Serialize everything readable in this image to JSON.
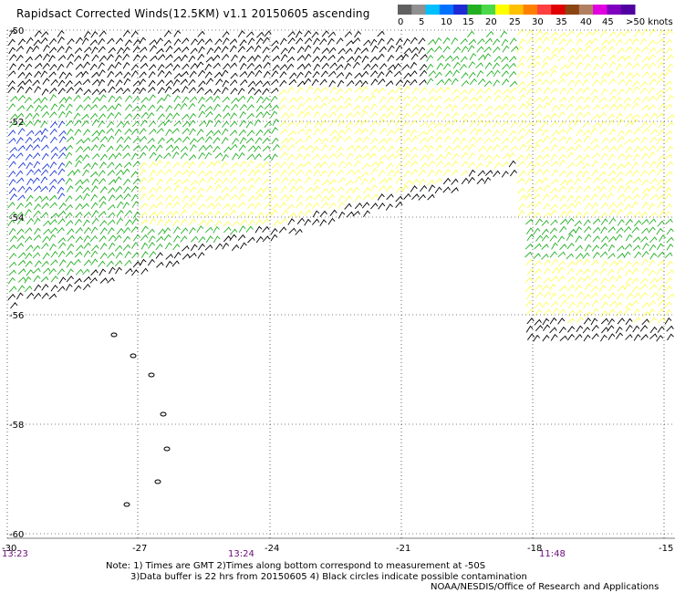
{
  "title": "Rapidsact Corrected Winds(12.5KM) v1.1 20150605 ascending",
  "legend": {
    "colors": [
      "#606060",
      "#909090",
      "#00bfff",
      "#0070ff",
      "#1e2ad6",
      "#22b022",
      "#4ad84a",
      "#ffff00",
      "#ffc000",
      "#ff8000",
      "#ff4040",
      "#e00000",
      "#8b4513",
      "#b08060",
      "#e000e0",
      "#8000c0",
      "#5000a0"
    ],
    "labels": [
      "0",
      "5",
      "10",
      "15",
      "20",
      "25",
      "30",
      "35",
      "40",
      "45",
      ">50 knots"
    ]
  },
  "axes": {
    "lat_labels": [
      "-50",
      "-52",
      "-54",
      "-56",
      "-58",
      "-60"
    ],
    "lon_labels": [
      "-30",
      "-27",
      "-24",
      "-21",
      "-18",
      "-15"
    ],
    "times": [
      "13:23",
      "13:24",
      "11:48"
    ]
  },
  "notes": {
    "line1": "Note: 1) Times are GMT 2)Times along bottom correspond to measurement at -50S",
    "line2": "3)Data buffer is 22 hrs from 20150605 4) Black circles indicate possible contamination",
    "credit": "NOAA/NESDIS/Office of Research and Applications"
  },
  "wind_colors": {
    "black": "#000000",
    "green": "#22b022",
    "light_green": "#55dd55",
    "yellow": "#ffff55",
    "blue": "#1e3ad6",
    "cyan": "#00bfff"
  }
}
